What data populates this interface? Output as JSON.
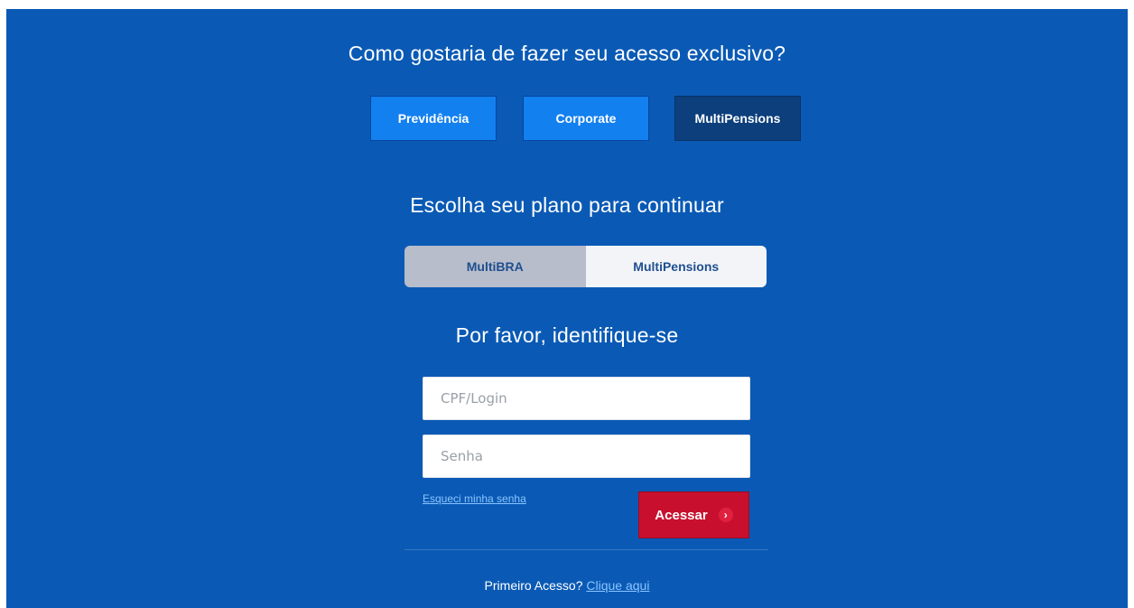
{
  "access": {
    "title": "Como gostaria de fazer seu acesso exclusivo?",
    "options": [
      "Previdência",
      "Corporate",
      "MultiPensions"
    ],
    "active": "MultiPensions"
  },
  "plan": {
    "title": "Escolha seu plano para continuar",
    "options": [
      "MultiBRA",
      "MultiPensions"
    ],
    "selected": "MultiPensions"
  },
  "login": {
    "title": "Por favor, identifique-se",
    "user_placeholder": "CPF/Login",
    "user_value": "",
    "password_placeholder": "Senha",
    "password_value": "",
    "forgot_link": "Esqueci minha senha",
    "submit_label": "Acessar",
    "submit_icon": "chevron-right-icon"
  },
  "footer": {
    "question": "Primeiro Acesso?",
    "link": "Clique aqui"
  },
  "colors": {
    "background": "#0a5ab5",
    "option_button": "#1380ef",
    "option_active": "#0c3f7c",
    "submit": "#c8102e",
    "link": "#8ac4ff"
  }
}
